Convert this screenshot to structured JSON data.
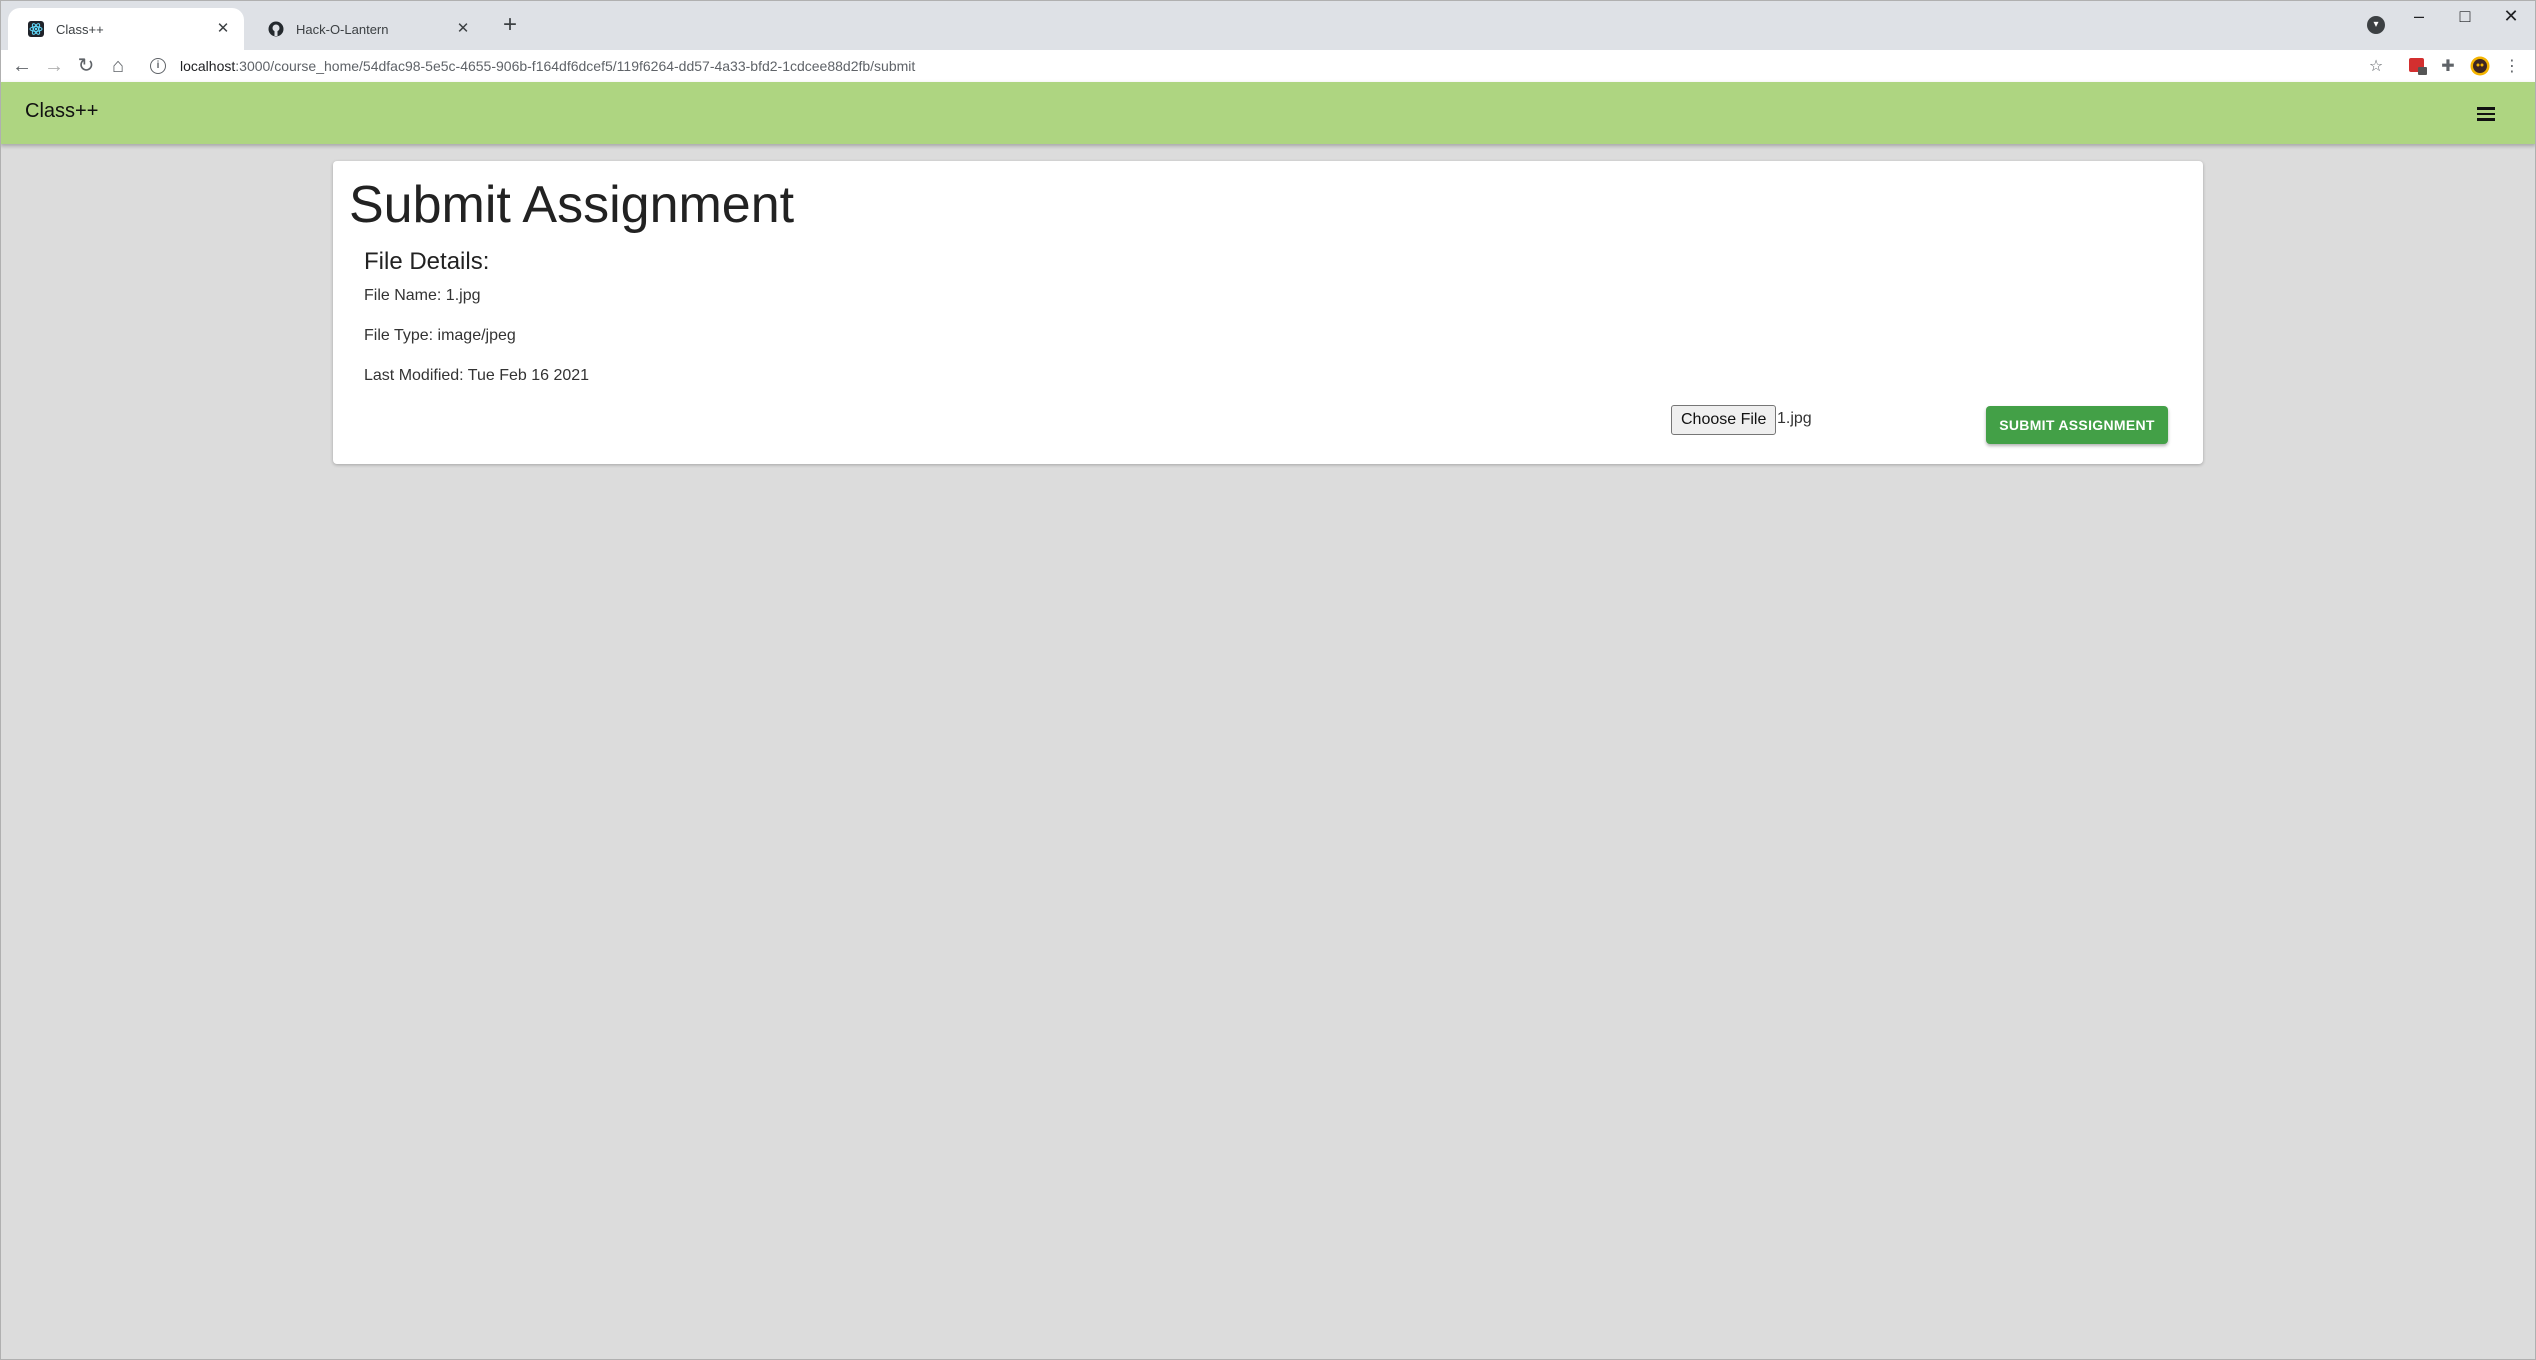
{
  "browser": {
    "tabs": [
      {
        "title": "Class++",
        "active": true
      },
      {
        "title": "Hack-O-Lantern",
        "active": false
      }
    ],
    "new_tab": "+",
    "url_host": "localhost",
    "url_rest": ":3000/course_home/54dfac98-5e5c-4655-906b-f164df6dcef5/119f6264-dd57-4a33-bfd2-1cdcee88d2fb/submit",
    "window_controls": {
      "minimize": "–",
      "maximize": "□",
      "close": "✕"
    },
    "nav_icons": {
      "back": "←",
      "forward": "→",
      "reload": "↻",
      "home": "⌂",
      "star": "☆",
      "extensions": "✚",
      "more": "⋮"
    }
  },
  "app": {
    "brand": "Class++",
    "accent": "#aed581",
    "button_color": "#43a047"
  },
  "page": {
    "title": "Submit Assignment",
    "file_details": {
      "heading": "File Details:",
      "name_line": "File Name: 1.jpg",
      "type_line": "File Type: image/jpeg",
      "modified_line": "Last Modified: Tue Feb 16 2021"
    },
    "file_input": {
      "button_label": "Choose File",
      "chosen_file": "1.jpg"
    },
    "submit_label": "SUBMIT ASSIGNMENT"
  }
}
